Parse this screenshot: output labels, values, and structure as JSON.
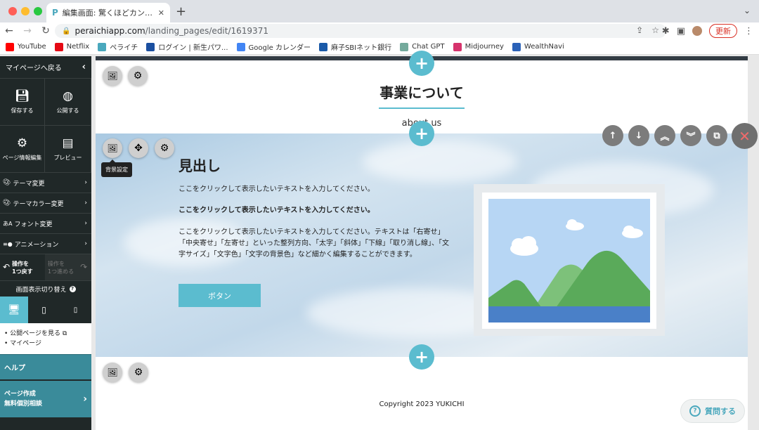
{
  "browser": {
    "tab_title": "編集画面: 驚くほどカンタン！無料",
    "url_host": "peraichiapp.com",
    "url_path": "/landing_pages/edit/1619371",
    "update_label": "更新",
    "bookmarks": [
      {
        "label": "YouTube",
        "color": "#ff0000"
      },
      {
        "label": "Netflix",
        "color": "#e50914"
      },
      {
        "label": "ペライチ",
        "color": "#4aa8bd"
      },
      {
        "label": "ログイン | 新生パワ...",
        "color": "#1b4fa0"
      },
      {
        "label": "Google カレンダー",
        "color": "#4285f4"
      },
      {
        "label": "麻子SBIネット銀行",
        "color": "#1a5aa8"
      },
      {
        "label": "Chat GPT",
        "color": "#74aa9c"
      },
      {
        "label": "Midjourney",
        "color": "#d6336c"
      },
      {
        "label": "WealthNavi",
        "color": "#2b62b8"
      }
    ]
  },
  "sidebar": {
    "back_label": "マイページへ戻る",
    "save_label": "保存する",
    "publish_label": "公開する",
    "page_info_label": "ページ情報編集",
    "preview_label": "プレビュー",
    "menu": [
      {
        "label": "テーマ変更"
      },
      {
        "label": "テーマカラー変更"
      },
      {
        "label": "フォント変更"
      },
      {
        "label": "アニメーション"
      }
    ],
    "undo_label": "操作を\n1つ戻す",
    "redo_label": "操作を\n1つ進める",
    "screen_switch_label": "画面表示切り替え",
    "links": [
      "公開ページを見る",
      "マイページ"
    ],
    "help_label": "ヘルプ",
    "consult_label_1": "ページ作成",
    "consult_label_2": "無料個別相談"
  },
  "canvas": {
    "section_title": "事業について",
    "section_subtitle": "about us",
    "tooltip": "背景設定",
    "heading": "見出し",
    "para1": "ここをクリックして表示したいテキストを入力してください。",
    "para2": "ここをクリックして表示したいテキストを入力してください。",
    "para3": "ここをクリックして表示したいテキストを入力してください。テキストは「右寄せ」「中央寄せ」「左寄せ」といった整列方向、「太字」「斜体」「下線」「取り消し線」、「文字サイズ」「文字色」「文字の背景色」など細かく編集することができます。",
    "button_label": "ボタン",
    "copyright": "Copyright 2023 YUKICHI"
  },
  "ask_label": "質問する",
  "colors": {
    "accent": "#5bbccf",
    "sidebar_bg": "#202828",
    "help_bg": "#3a8b9a"
  }
}
